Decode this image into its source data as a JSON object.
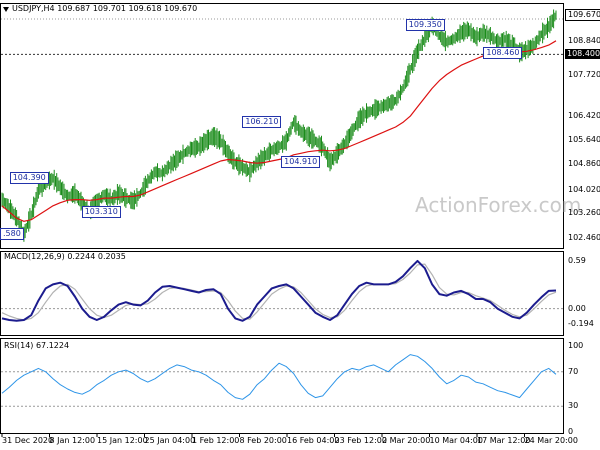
{
  "main_header": {
    "symbol": "USDJPY,H4",
    "open": "109.687",
    "high": "109.701",
    "low": "109.618",
    "close": "109.670"
  },
  "macd_header": {
    "label": "MACD(12,26,9)",
    "main": "0.2244",
    "signal": "0.2035"
  },
  "rsi_header": {
    "label": "RSI(14)",
    "value": "67.1224"
  },
  "watermark": "ActionForex.com",
  "colors": {
    "price": "#1b8c1b",
    "ema": "#dd1111",
    "macd": "#1c1c8e",
    "macd_signal": "#b3b3b3",
    "rsi": "#2e95e8",
    "tag_border": "#2233aa",
    "grid_frame": "#000000"
  },
  "chart_data": [
    {
      "type": "line",
      "panel": "price",
      "price_axis_ticks": [
        "108.840",
        "107.720",
        "106.420",
        "105.640",
        "104.860",
        "104.020",
        "103.260",
        "102.460"
      ],
      "ylim": [
        102.2,
        109.9
      ],
      "current_price_box": "109.670",
      "horizontal_line_box": "108.400",
      "horizontal_line_value": 108.4,
      "annotations": [
        {
          "text": "104.390",
          "value": 104.39,
          "at": 0.05
        },
        {
          "text": ".580",
          "value": 102.58,
          "at": 0.0
        },
        {
          "text": "103.310",
          "value": 103.31,
          "at": 0.18
        },
        {
          "text": "106.210",
          "value": 106.21,
          "at": 0.47
        },
        {
          "text": "104.910",
          "value": 104.91,
          "at": 0.54
        },
        {
          "text": "109.350",
          "value": 109.35,
          "at": 0.765
        },
        {
          "text": "108.460",
          "value": 108.46,
          "at": 0.905
        }
      ],
      "series": [
        {
          "name": "",
          "role": "price",
          "values": [
            103.7,
            103.45,
            103.1,
            102.58,
            103.2,
            104.0,
            104.25,
            104.39,
            104.1,
            103.8,
            103.9,
            103.6,
            103.31,
            103.6,
            103.85,
            103.7,
            103.9,
            103.75,
            103.65,
            103.9,
            104.3,
            104.6,
            104.55,
            104.8,
            105.0,
            105.2,
            105.35,
            105.4,
            105.6,
            105.75,
            105.6,
            105.2,
            104.9,
            104.75,
            104.6,
            104.9,
            105.1,
            105.3,
            105.4,
            105.6,
            106.21,
            105.9,
            105.75,
            105.6,
            105.4,
            104.91,
            105.2,
            105.5,
            105.9,
            106.3,
            106.5,
            106.6,
            106.7,
            106.8,
            106.9,
            107.3,
            107.9,
            108.5,
            108.9,
            109.35,
            109.0,
            108.8,
            108.9,
            109.1,
            109.2,
            108.95,
            109.1,
            109.0,
            108.8,
            108.9,
            108.7,
            108.46,
            108.55,
            108.7,
            109.05,
            109.3,
            109.67
          ]
        },
        {
          "name": "",
          "role": "ema",
          "values": [
            103.5,
            103.3,
            103.1,
            103.0,
            103.05,
            103.2,
            103.35,
            103.5,
            103.6,
            103.68,
            103.7,
            103.7,
            103.68,
            103.7,
            103.75,
            103.75,
            103.78,
            103.8,
            103.8,
            103.85,
            103.95,
            104.05,
            104.15,
            104.25,
            104.35,
            104.45,
            104.55,
            104.65,
            104.75,
            104.85,
            104.95,
            105.0,
            104.98,
            104.95,
            104.9,
            104.88,
            104.9,
            104.95,
            105.0,
            105.05,
            105.15,
            105.2,
            105.25,
            105.28,
            105.3,
            105.28,
            105.3,
            105.35,
            105.45,
            105.55,
            105.65,
            105.75,
            105.85,
            105.95,
            106.05,
            106.2,
            106.4,
            106.7,
            107.0,
            107.3,
            107.55,
            107.75,
            107.9,
            108.05,
            108.15,
            108.25,
            108.35,
            108.4,
            108.45,
            108.5,
            108.5,
            108.48,
            108.5,
            108.55,
            108.62,
            108.7,
            108.84
          ]
        }
      ]
    },
    {
      "type": "line",
      "panel": "macd",
      "axis_ticks": [
        "0.59",
        "0.00",
        "-0.194"
      ],
      "ylim": [
        -0.3,
        0.65
      ],
      "series": [
        {
          "name": "",
          "role": "macd",
          "values": [
            -0.12,
            -0.14,
            -0.15,
            -0.14,
            -0.08,
            0.1,
            0.25,
            0.3,
            0.32,
            0.28,
            0.15,
            0.0,
            -0.1,
            -0.14,
            -0.1,
            -0.02,
            0.05,
            0.08,
            0.05,
            0.04,
            0.1,
            0.2,
            0.27,
            0.28,
            0.26,
            0.24,
            0.22,
            0.2,
            0.23,
            0.24,
            0.18,
            0.0,
            -0.12,
            -0.15,
            -0.1,
            0.05,
            0.15,
            0.25,
            0.28,
            0.3,
            0.25,
            0.15,
            0.05,
            -0.05,
            -0.1,
            -0.14,
            -0.08,
            0.05,
            0.18,
            0.28,
            0.32,
            0.3,
            0.3,
            0.3,
            0.33,
            0.4,
            0.5,
            0.59,
            0.5,
            0.3,
            0.18,
            0.16,
            0.2,
            0.22,
            0.18,
            0.12,
            0.12,
            0.08,
            0.0,
            -0.05,
            -0.1,
            -0.12,
            -0.05,
            0.05,
            0.14,
            0.22,
            0.2244
          ]
        },
        {
          "name": "",
          "role": "signal",
          "values": [
            -0.05,
            -0.09,
            -0.12,
            -0.14,
            -0.12,
            -0.05,
            0.08,
            0.2,
            0.28,
            0.3,
            0.24,
            0.12,
            0.0,
            -0.08,
            -0.11,
            -0.08,
            -0.02,
            0.04,
            0.06,
            0.05,
            0.06,
            0.12,
            0.2,
            0.25,
            0.26,
            0.25,
            0.23,
            0.21,
            0.21,
            0.22,
            0.2,
            0.1,
            -0.03,
            -0.12,
            -0.13,
            -0.04,
            0.07,
            0.18,
            0.24,
            0.28,
            0.27,
            0.2,
            0.1,
            0.0,
            -0.07,
            -0.11,
            -0.1,
            -0.02,
            0.1,
            0.21,
            0.28,
            0.3,
            0.3,
            0.3,
            0.31,
            0.36,
            0.44,
            0.54,
            0.55,
            0.42,
            0.26,
            0.18,
            0.17,
            0.2,
            0.2,
            0.16,
            0.13,
            0.1,
            0.04,
            -0.02,
            -0.07,
            -0.1,
            -0.08,
            0.0,
            0.09,
            0.17,
            0.2035
          ]
        }
      ]
    },
    {
      "type": "line",
      "panel": "rsi",
      "axis_ticks": [
        "100",
        "70",
        "30",
        "0"
      ],
      "ylim": [
        0,
        100
      ],
      "reference_levels": [
        70,
        30
      ],
      "series": [
        {
          "name": "",
          "role": "rsi",
          "values": [
            45,
            52,
            60,
            66,
            70,
            74,
            70,
            62,
            55,
            50,
            46,
            44,
            48,
            55,
            60,
            66,
            70,
            72,
            68,
            62,
            58,
            62,
            68,
            74,
            78,
            76,
            72,
            70,
            66,
            60,
            55,
            46,
            40,
            38,
            44,
            55,
            62,
            72,
            80,
            76,
            68,
            55,
            45,
            40,
            42,
            52,
            62,
            70,
            74,
            72,
            76,
            78,
            74,
            70,
            78,
            84,
            90,
            88,
            82,
            74,
            64,
            56,
            60,
            66,
            64,
            58,
            56,
            52,
            48,
            46,
            43,
            40,
            50,
            60,
            70,
            74,
            67.1224
          ]
        }
      ]
    }
  ],
  "date_axis": [
    "31 Dec 2020",
    "8 Jan 12:00",
    "15 Jan 12:00",
    "25 Jan 04:00",
    "1 Feb 12:00",
    "8 Feb 20:00",
    "16 Feb 04:00",
    "23 Feb 12:00",
    "2 Mar 20:00",
    "10 Mar 04:00",
    "17 Mar 12:00",
    "24 Mar 20:00"
  ]
}
